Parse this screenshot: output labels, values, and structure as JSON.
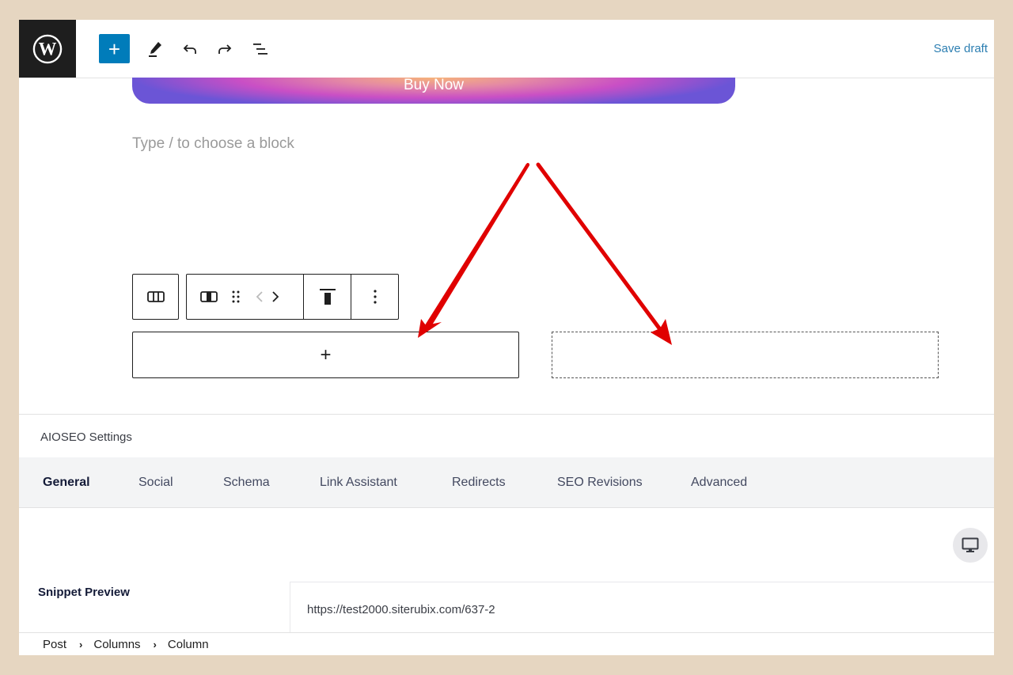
{
  "topbar": {
    "logo": "wordpress-logo",
    "tools": [
      {
        "name": "add-block",
        "icon": "plus-icon"
      },
      {
        "name": "tools",
        "icon": "pencil-icon"
      },
      {
        "name": "undo",
        "icon": "undo-icon"
      },
      {
        "name": "redo",
        "icon": "redo-icon"
      },
      {
        "name": "document-overview",
        "icon": "list-view-icon"
      }
    ],
    "add_label": "+",
    "save_draft": "Save draft"
  },
  "editor": {
    "buy_button": "Buy Now",
    "placeholder": "Type / to choose a block",
    "block_toolbar": {
      "parent_icon": "columns-icon",
      "column_icon": "column-icon",
      "drag_icon": "drag-handle-icon",
      "move_icons": [
        "chevron-left-icon",
        "chevron-right-icon"
      ],
      "align_icon": "align-top-icon",
      "more_icon": "more-vertical-icon"
    },
    "left_column_appender": "+",
    "annotation_color": "#e00000"
  },
  "aioseo": {
    "title": "AIOSEO Settings",
    "tabs": [
      {
        "label": "General",
        "active": true
      },
      {
        "label": "Social",
        "active": false
      },
      {
        "label": "Schema",
        "active": false
      },
      {
        "label": "Link Assistant",
        "active": false
      },
      {
        "label": "Redirects",
        "active": false
      },
      {
        "label": "SEO Revisions",
        "active": false
      },
      {
        "label": "Advanced",
        "active": false
      }
    ],
    "preview_device_icon": "desktop-icon",
    "snippet_label": "Snippet Preview",
    "snippet_url": "https://test2000.siterubix.com/637-2"
  },
  "breadcrumb": [
    "Post",
    "Columns",
    "Column"
  ],
  "colors": {
    "accent": "#007cba",
    "save_draft": "#2d7fb2",
    "wp_bar": "#1e1e1e",
    "frame_bg": "#e6d6c1"
  }
}
